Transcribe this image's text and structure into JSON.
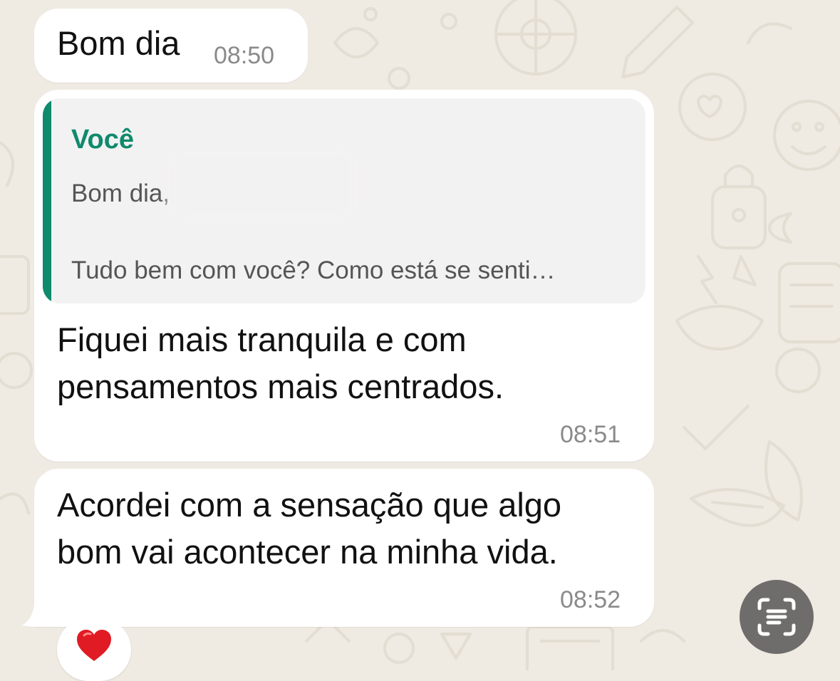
{
  "theme": {
    "wallpaper_color": "#efeae2",
    "bubble_color": "#ffffff",
    "quote_accent": "#0f8a6c",
    "timestamp_color": "#8a8a8a"
  },
  "messages": [
    {
      "text_lines": [
        "Bom dia"
      ],
      "time": "08:50"
    },
    {
      "quote": {
        "author": "Você",
        "line1": "Bom dia, ",
        "line2": "Tudo bem com você? Como está se senti…"
      },
      "text_lines": [
        "Fiquei mais tranquila e com",
        "pensamentos mais centrados."
      ],
      "time": "08:51"
    },
    {
      "text_lines": [
        "Acordei com a sensação que algo",
        "bom vai acontecer na minha vida."
      ],
      "time": "08:52",
      "reaction": "heart"
    }
  ],
  "controls": {
    "scan_icon": "text-scan-icon"
  }
}
